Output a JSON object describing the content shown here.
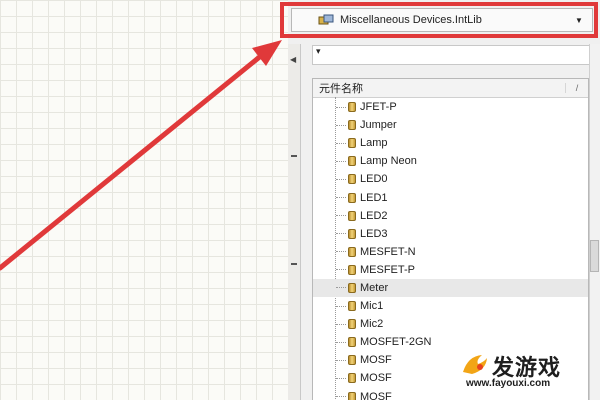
{
  "library_selector": {
    "value": "Miscellaneous Devices.IntLib",
    "icon": "library-icon",
    "arrow": "▼"
  },
  "filter": {
    "caret": "▾"
  },
  "component_list": {
    "header": "元件名称",
    "sort_glyph": "/",
    "selected_index": 11,
    "items": [
      "JFET-P",
      "Jumper",
      "Lamp",
      "Lamp Neon",
      "LED0",
      "LED1",
      "LED2",
      "LED3",
      "MESFET-N",
      "MESFET-P",
      "Meter",
      "Mic1",
      "Mic2",
      "MOSFET-2GN",
      "MOSF",
      "MOSF",
      "MOSF"
    ]
  },
  "watermark": {
    "brand": "发游戏",
    "url": "www.fayouxi.com",
    "logo": "fa-logo-icon"
  },
  "annotation": {
    "highlight_color": "#e0393a",
    "arrow_color": "#e0393a"
  }
}
